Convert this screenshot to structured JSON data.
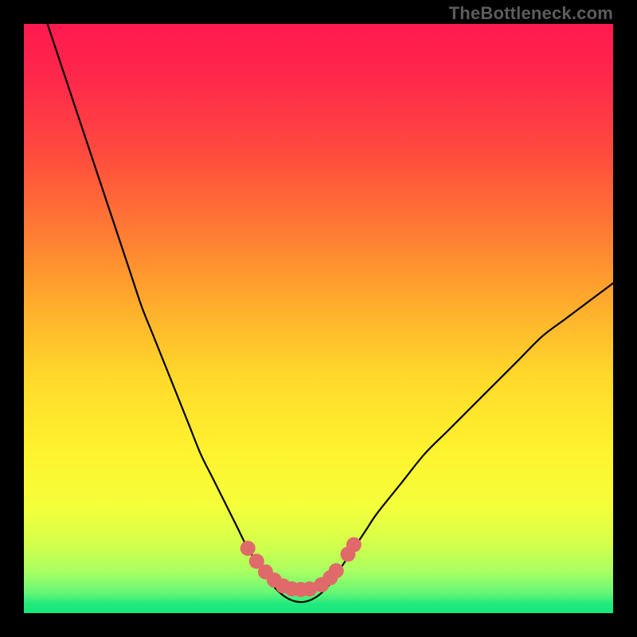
{
  "watermark": "TheBottleneck.com",
  "colors": {
    "black": "#000000",
    "curve": "#000000",
    "marker": "#e06a6a",
    "green": "#16e87a"
  },
  "chart_data": {
    "type": "line",
    "title": "",
    "xlabel": "",
    "ylabel": "",
    "xlim": [
      0,
      100
    ],
    "ylim": [
      0,
      100
    ],
    "series": [
      {
        "name": "bottleneck-curve",
        "x": [
          4,
          6,
          8,
          10,
          12,
          14,
          16,
          18,
          20,
          22,
          24,
          26,
          28,
          30,
          32,
          34,
          36,
          38,
          40,
          42,
          44,
          46,
          48,
          50,
          52,
          54,
          56,
          58,
          60,
          64,
          68,
          72,
          76,
          80,
          84,
          88,
          92,
          96,
          100
        ],
        "y": [
          100,
          94,
          88,
          82,
          76,
          70,
          64,
          58,
          52,
          47,
          42,
          37,
          32,
          27,
          23,
          19,
          15,
          11,
          8,
          5,
          3,
          2,
          2,
          3,
          5,
          8,
          11,
          14,
          17,
          22,
          27,
          31,
          35,
          39,
          43,
          47,
          50,
          53,
          56
        ]
      }
    ],
    "markers": {
      "name": "highlight-dots",
      "x": [
        38,
        39.5,
        41,
        42.5,
        44,
        45.5,
        47,
        48.5,
        50.5,
        52,
        53,
        55,
        56
      ],
      "y": [
        11,
        8.8,
        7,
        5.6,
        4.6,
        4.1,
        4,
        4.1,
        4.8,
        6,
        7.2,
        10,
        11.6
      ]
    },
    "gradient_stops": [
      {
        "pos": 0.0,
        "color": "#ff1950"
      },
      {
        "pos": 0.1,
        "color": "#ff2a4a"
      },
      {
        "pos": 0.22,
        "color": "#ff4b3e"
      },
      {
        "pos": 0.35,
        "color": "#ff7a33"
      },
      {
        "pos": 0.48,
        "color": "#ffae2c"
      },
      {
        "pos": 0.6,
        "color": "#ffd92a"
      },
      {
        "pos": 0.72,
        "color": "#fff22e"
      },
      {
        "pos": 0.82,
        "color": "#f4ff3a"
      },
      {
        "pos": 0.88,
        "color": "#d6ff4a"
      },
      {
        "pos": 0.93,
        "color": "#a8ff62"
      },
      {
        "pos": 0.965,
        "color": "#66f777"
      },
      {
        "pos": 0.985,
        "color": "#20e97c"
      },
      {
        "pos": 1.0,
        "color": "#16e87a"
      }
    ]
  }
}
